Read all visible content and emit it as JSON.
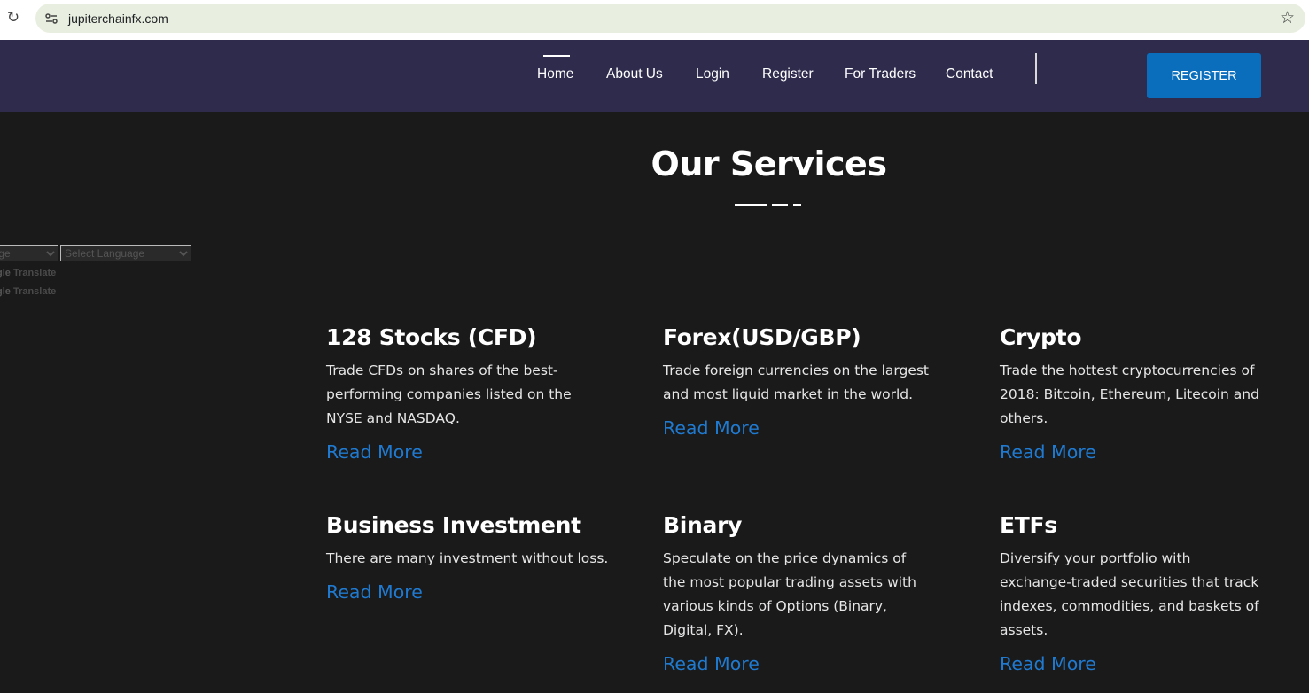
{
  "browser": {
    "url": "jupiterchainfx.com"
  },
  "nav": {
    "items": [
      {
        "label": "Home",
        "active": true
      },
      {
        "label": "About Us"
      },
      {
        "label": "Login"
      },
      {
        "label": "Register"
      },
      {
        "label": "For Traders"
      },
      {
        "label": "Contact"
      }
    ],
    "cta_label": "REGISTER"
  },
  "services": {
    "title": "Our Services",
    "cards": [
      {
        "title": "128 Stocks (CFD)",
        "desc": "Trade CFDs on shares of the best-performing companies listed on the NYSE and NASDAQ.",
        "link": "Read More"
      },
      {
        "title": "Forex(USD/GBP)",
        "desc": "Trade foreign currencies on the largest and most liquid market in the world.",
        "link": "Read More"
      },
      {
        "title": "Crypto",
        "desc": "Trade the hottest cryptocurrencies of 2018: Bitcoin, Ethereum, Litecoin and others.",
        "link": "Read More"
      },
      {
        "title": "Business Investment",
        "desc": "There are many investment without loss.",
        "link": "Read More"
      },
      {
        "title": "Binary",
        "desc": "Speculate on the price dynamics of the most popular trading assets with various kinds of Options (Binary, Digital, FX).",
        "link": "Read More"
      },
      {
        "title": "ETFs",
        "desc": "Diversify your portfolio with exchange-traded securities that track indexes, commodities, and baskets of assets.",
        "link": "Read More"
      }
    ]
  },
  "translate": {
    "select_1": "uage",
    "select_2": "Select Language",
    "widget_1": "Translate",
    "widget_2": "Translate"
  },
  "colors": {
    "navbar": "#2e2b4d",
    "background": "#1a1a1b",
    "accent": "#0a6ebd",
    "link": "#1f7ad0"
  }
}
